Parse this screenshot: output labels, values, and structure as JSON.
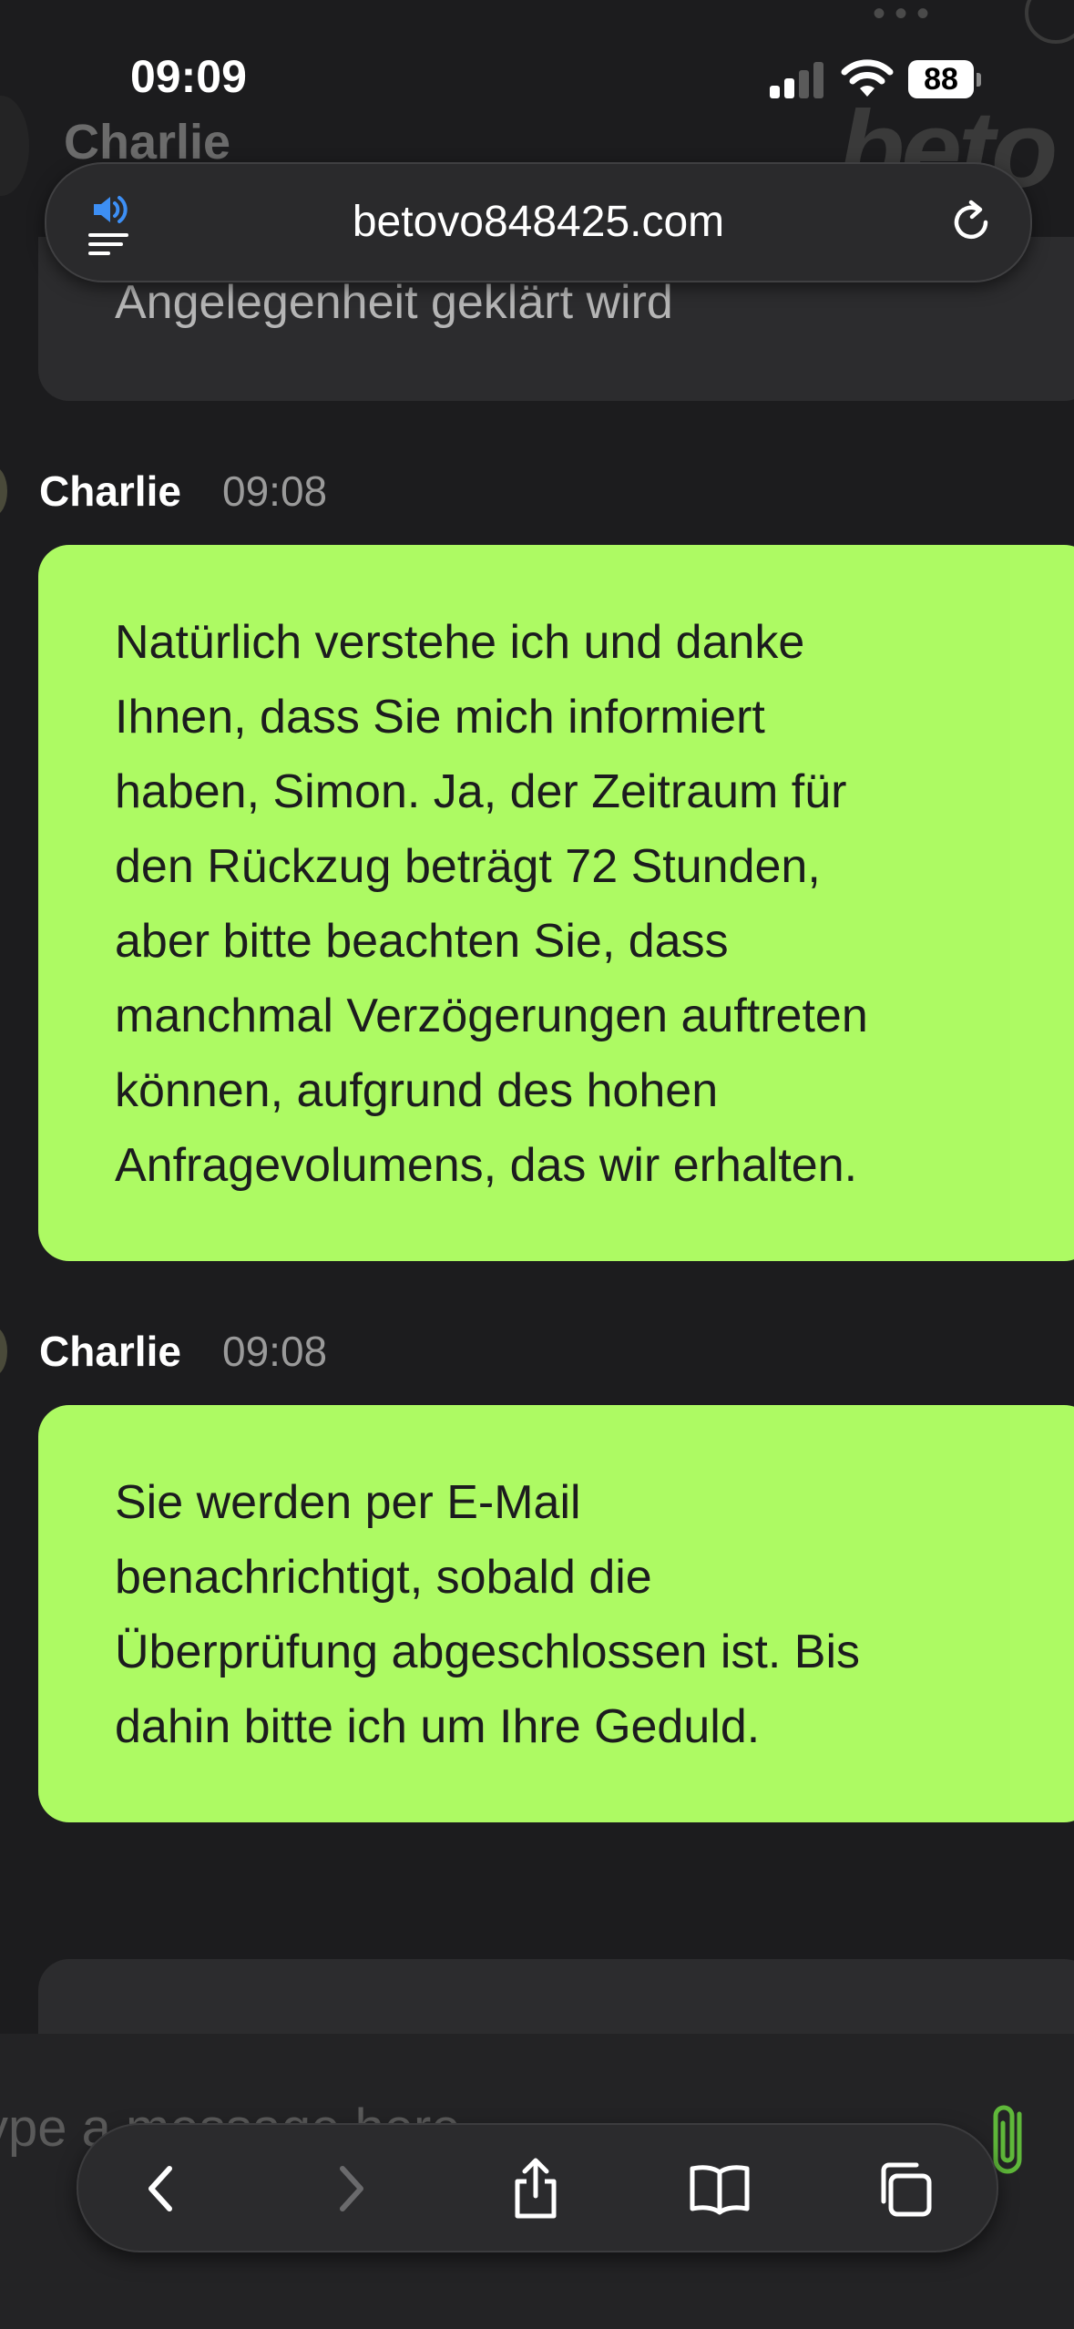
{
  "status_bar": {
    "time": "09:09",
    "battery": "88"
  },
  "background_header": {
    "name": "Charlie",
    "logo_text": "beto"
  },
  "url_bar": {
    "domain": "betovo848425.com"
  },
  "chat": {
    "previous_message_tail": "Angelegenheit geklärt wird",
    "messages": [
      {
        "sender": "Charlie",
        "time": "09:08",
        "lines": [
          "Natürlich verstehe ich und danke",
          "Ihnen, dass Sie mich informiert",
          "haben, Simon. Ja, der Zeitraum für",
          "den Rückzug beträgt 72 Stunden,",
          "aber bitte beachten Sie, dass",
          "manchmal Verzögerungen auftreten",
          "können, aufgrund des hohen",
          "Anfragevolumens, das wir erhalten."
        ]
      },
      {
        "sender": "Charlie",
        "time": "09:08",
        "lines": [
          "Sie werden per E-Mail",
          "benachrichtigt, sobald die",
          "Überprüfung abgeschlossen ist. Bis",
          "dahin bitte ich um Ihre Geduld."
        ]
      }
    ]
  },
  "composer": {
    "placeholder": "ype a message here"
  },
  "colors": {
    "bubble": "#adfa63",
    "background": "#1c1c1e",
    "accent_blue": "#3d8ff5",
    "attach_green": "#5fb83a"
  },
  "icons": {
    "speaker": "speaker-icon",
    "reload": "reload-icon",
    "attach": "paperclip-icon",
    "back": "chevron-left-icon",
    "forward": "chevron-right-icon",
    "share": "share-icon",
    "bookmarks": "book-icon",
    "tabs": "tabs-icon"
  }
}
